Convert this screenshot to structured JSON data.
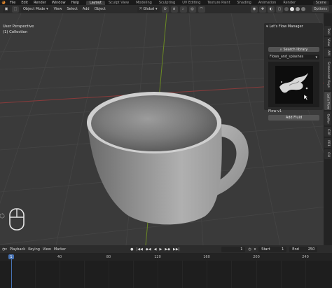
{
  "topbar": {
    "menu": [
      "File",
      "Edit",
      "Render",
      "Window",
      "Help"
    ],
    "tabs": [
      "Layout",
      "Sculpt View",
      "Modeling",
      "Sculpting",
      "UV Editing",
      "Texture Paint",
      "Shading",
      "Animation",
      "Render",
      "Scene"
    ],
    "active_tab": "Layout"
  },
  "header": {
    "mode": "Object Mode",
    "menus": [
      "View",
      "Select",
      "Add",
      "Object"
    ],
    "transform_orientation": "Global",
    "options_label": "Options"
  },
  "viewport": {
    "view_name": "User Perspective",
    "collection": "(1) Collection",
    "background_color": "#3a3a3a"
  },
  "npanel": {
    "title": "Let's Flow Manager",
    "search_label": "Search library",
    "selected_flow": "Flows_and_splashes",
    "flow_label": "Flow v1",
    "add_button": "Add Fluid"
  },
  "side_tabs": [
    "Tool",
    "View",
    "AM",
    "Screencast Keys",
    "Let's Flow",
    "Geffer",
    "C2P",
    "PR1",
    "CH"
  ],
  "side_tabs_active": "Let's Flow",
  "timeline": {
    "playback": "Playback",
    "keying": "Keying",
    "view": "View",
    "marker": "Marker",
    "current_frame": "1",
    "start_label": "Start",
    "start": "1",
    "end_label": "End",
    "end": "250",
    "playhead": "1",
    "ruler_ticks": [
      "40",
      "80",
      "120",
      "160",
      "200",
      "240"
    ]
  },
  "colors": {
    "accent": "#4772b3",
    "blender_orange": "#e78a2c",
    "axis_red": "#8a3a3a",
    "axis_green": "#6b8a23"
  }
}
